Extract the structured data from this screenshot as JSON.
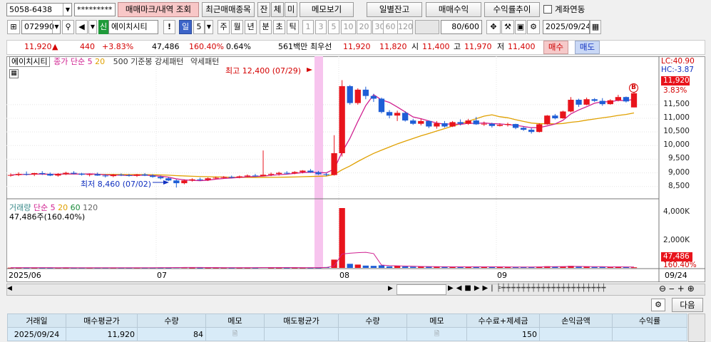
{
  "toolbar1": {
    "account": "5058-6438",
    "password": "*********",
    "buttons": [
      "매매마크/내역 조회",
      "최근매매종목",
      "잔",
      "체",
      "미",
      "메모보기",
      "일별잔고",
      "매매수익",
      "수익률추이"
    ],
    "link_label": "계좌연동"
  },
  "toolbar2": {
    "code": "072990",
    "badge": "신",
    "name": "에이치시티",
    "alert": "!",
    "period_sel": "일",
    "period_num": "5",
    "periods": [
      "주",
      "월",
      "년",
      "분",
      "초",
      "틱"
    ],
    "intervals": [
      "1",
      "3",
      "5",
      "10",
      "20",
      "30",
      "60",
      "120"
    ],
    "count": "80",
    "count_total": "/600",
    "date": "2025/09/24"
  },
  "ticker": {
    "price": "11,920",
    "arrow": "▲",
    "change": "440",
    "change_pct": "+3.83%",
    "volume": "47,486",
    "volume_pct": "160.40%",
    "turnover": "0.64%",
    "amount": "561백만",
    "sell_label": "최우선",
    "ask": "11,920",
    "bid": "11,820",
    "open_label": "시",
    "open": "11,400",
    "high_label": "고",
    "high": "11,970",
    "low_label": "저",
    "low": "11,400",
    "buy_btn": "매수",
    "sell_btn": "매도"
  },
  "legend": {
    "stock": "에이치시티",
    "close_ma": "종가 단순 5",
    "ma20": "20",
    "ma500": "500",
    "pattern": "기준봉 강세패턴",
    "pattern2": "약세패턴"
  },
  "annotations": {
    "high": "최고 12,400 (07/29)",
    "low": "최저 8,460 (07/02)",
    "lc": "LC:40.90",
    "hc": "HC:-3.87",
    "price_tag": "11,920",
    "pct_tag": "3.83%",
    "vol_tag": "47,486",
    "vol_pct_tag": "160.40%",
    "b_mark": "B"
  },
  "volume_legend": {
    "label": "거래량",
    "ma": "단순 5",
    "ma20": "20",
    "ma60": "60",
    "ma120": "120",
    "current": "47,486주(160.40%)"
  },
  "x_axis": [
    "2025/06",
    "07",
    "08",
    "09",
    "09/24"
  ],
  "chart_data": {
    "type": "candlestick",
    "y_ticks": [
      "11,500",
      "11,000",
      "10,500",
      "10,000",
      "9,500",
      "9,000",
      "8,500"
    ],
    "vol_ticks": [
      "4,000K",
      "2,000K"
    ],
    "ylim": [
      8100,
      12700
    ],
    "ohlc": [
      [
        8900,
        8980,
        8860,
        8920
      ],
      [
        8920,
        9020,
        8880,
        8960
      ],
      [
        8960,
        9050,
        8900,
        8940
      ],
      [
        8940,
        9000,
        8880,
        8990
      ],
      [
        8990,
        9060,
        8920,
        8960
      ],
      [
        8960,
        9010,
        8880,
        8900
      ],
      [
        8900,
        8990,
        8860,
        8960
      ],
      [
        8960,
        9040,
        8920,
        9000
      ],
      [
        9000,
        9060,
        8940,
        8970
      ],
      [
        8970,
        9000,
        8900,
        8930
      ],
      [
        8930,
        8980,
        8870,
        8950
      ],
      [
        8950,
        9010,
        8890,
        8900
      ],
      [
        8900,
        8950,
        8830,
        8880
      ],
      [
        8880,
        8960,
        8840,
        8930
      ],
      [
        8930,
        8980,
        8880,
        8910
      ],
      [
        8910,
        8960,
        8860,
        8890
      ],
      [
        8890,
        8960,
        8850,
        8940
      ],
      [
        8940,
        8990,
        8880,
        8900
      ],
      [
        8900,
        8950,
        8820,
        8850
      ],
      [
        8850,
        8900,
        8760,
        8800
      ],
      [
        8800,
        8840,
        8700,
        8720
      ],
      [
        8720,
        8760,
        8460,
        8620
      ],
      [
        8620,
        8760,
        8580,
        8720
      ],
      [
        8720,
        8800,
        8680,
        8760
      ],
      [
        8760,
        8820,
        8700,
        8740
      ],
      [
        8740,
        8830,
        8700,
        8800
      ],
      [
        8800,
        8860,
        8760,
        8820
      ],
      [
        8820,
        8880,
        8780,
        8850
      ],
      [
        8850,
        8900,
        8800,
        8830
      ],
      [
        8830,
        8900,
        8800,
        8870
      ],
      [
        8870,
        8940,
        8840,
        8900
      ],
      [
        8900,
        8960,
        8860,
        8880
      ],
      [
        8880,
        9820,
        8880,
        8930
      ],
      [
        8930,
        9010,
        8880,
        8960
      ],
      [
        8960,
        9040,
        8900,
        9000
      ],
      [
        9000,
        9060,
        8940,
        8980
      ],
      [
        8980,
        9060,
        8950,
        9030
      ],
      [
        9030,
        9100,
        8980,
        9080
      ],
      [
        9080,
        9140,
        9000,
        9020
      ],
      [
        9020,
        9070,
        8920,
        8950
      ],
      [
        8950,
        9000,
        8880,
        8920
      ],
      [
        8920,
        10380,
        8900,
        9720
      ],
      [
        9720,
        12400,
        9600,
        12180
      ],
      [
        12180,
        12220,
        11500,
        11560
      ],
      [
        11560,
        12100,
        11500,
        12050
      ],
      [
        12050,
        12160,
        11700,
        11820
      ],
      [
        11820,
        11900,
        11600,
        11720
      ],
      [
        11720,
        11760,
        11180,
        11230
      ],
      [
        11230,
        11300,
        11000,
        11100
      ],
      [
        11100,
        11280,
        10900,
        11200
      ],
      [
        11200,
        11260,
        10880,
        10920
      ],
      [
        10920,
        10980,
        10760,
        10800
      ],
      [
        10800,
        10980,
        10740,
        10900
      ],
      [
        10900,
        10920,
        10640,
        10700
      ],
      [
        10700,
        10900,
        10620,
        10820
      ],
      [
        10820,
        10900,
        10660,
        10700
      ],
      [
        10700,
        10900,
        10680,
        10860
      ],
      [
        10860,
        10960,
        10740,
        10800
      ],
      [
        10800,
        10980,
        10760,
        10920
      ],
      [
        10920,
        11050,
        10760,
        10780
      ],
      [
        10780,
        10880,
        10720,
        10800
      ],
      [
        10800,
        10840,
        10660,
        10720
      ],
      [
        10720,
        10820,
        10700,
        10760
      ],
      [
        10760,
        10840,
        10700,
        10790
      ],
      [
        10790,
        10800,
        10600,
        10650
      ],
      [
        10650,
        10700,
        10540,
        10580
      ],
      [
        10580,
        10640,
        10440,
        10500
      ],
      [
        10500,
        10820,
        10480,
        10780
      ],
      [
        10780,
        11120,
        10760,
        11100
      ],
      [
        11100,
        11160,
        10960,
        11000
      ],
      [
        11000,
        11280,
        10980,
        11250
      ],
      [
        11250,
        11780,
        11220,
        11680
      ],
      [
        11680,
        11720,
        11420,
        11500
      ],
      [
        11500,
        11760,
        11480,
        11700
      ],
      [
        11700,
        11740,
        11600,
        11640
      ],
      [
        11640,
        11740,
        11460,
        11520
      ],
      [
        11520,
        11700,
        11500,
        11660
      ],
      [
        11660,
        11860,
        11620,
        11780
      ],
      [
        11780,
        11800,
        11580,
        11620
      ],
      [
        11400,
        11970,
        11400,
        11920
      ]
    ],
    "volume": [
      18,
      22,
      15,
      20,
      17,
      14,
      19,
      24,
      12,
      16,
      15,
      18,
      14,
      20,
      13,
      15,
      22,
      17,
      19,
      30,
      26,
      45,
      40,
      25,
      22,
      19,
      17,
      20,
      16,
      23,
      18,
      21,
      55,
      24,
      20,
      18,
      22,
      26,
      28,
      24,
      60,
      650,
      4700,
      320,
      260,
      180,
      160,
      200,
      120,
      140,
      110,
      90,
      100,
      85,
      95,
      80,
      75,
      70,
      90,
      110,
      80,
      70,
      65,
      75,
      60,
      70,
      85,
      95,
      130,
      110,
      90,
      160,
      90,
      85,
      70,
      75,
      80,
      95,
      60,
      47
    ]
  },
  "bottom": {
    "detail_label": "다음",
    "headers": [
      "거래일",
      "매수평균가",
      "수량",
      "메모",
      "매도평균가",
      "수량",
      "메모",
      "수수료+제세금",
      "손익금액",
      "수익률"
    ],
    "rows": [
      [
        "2025/09/24",
        "11,920",
        "84",
        "",
        "",
        "",
        "",
        "150",
        "",
        ""
      ]
    ]
  },
  "colors": {
    "up": "#e8141c",
    "down": "#1f5ed6",
    "ma5": "#d02090",
    "ma20": "#e0a000"
  }
}
